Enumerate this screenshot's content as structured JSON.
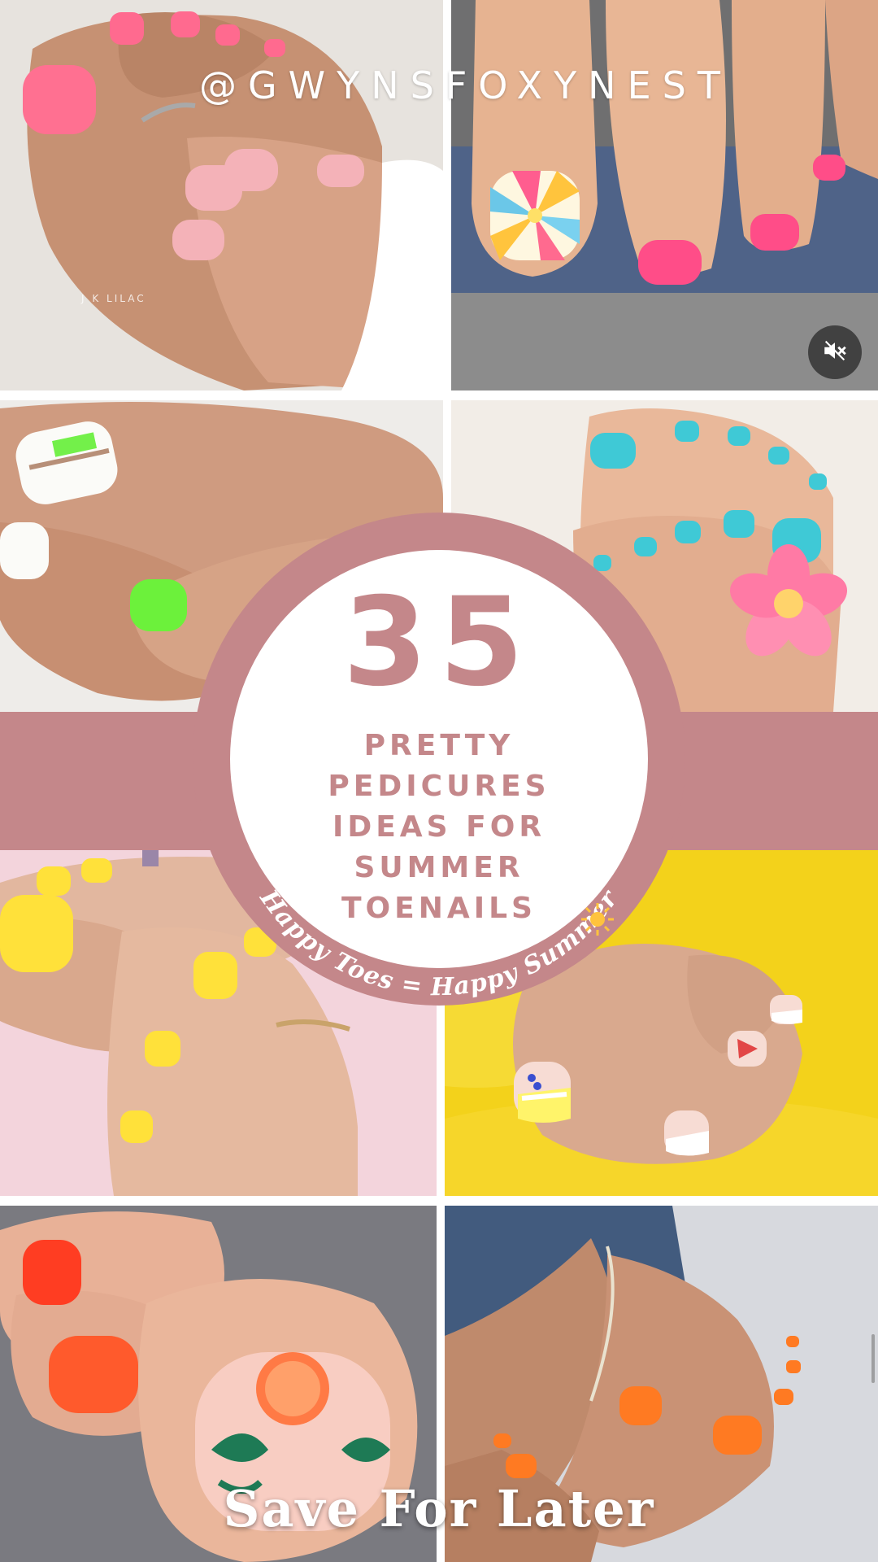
{
  "watermark": "@GWYNSFOXYNEST",
  "headline": {
    "number": "35",
    "lines": [
      "PRETTY",
      "PEDICURES",
      "IDEAS FOR",
      "SUMMER",
      "TOENAILS"
    ]
  },
  "tagline": "Happy Toes = Happy Summer",
  "cta": "Save For Later",
  "tiles": [
    {
      "name": "neon-pink-pedicure-photo",
      "credit": "J K LILAC"
    },
    {
      "name": "sunburst-toe-art-photo"
    },
    {
      "name": "neon-green-white-stripe-photo"
    },
    {
      "name": "turquoise-plumeria-photo"
    },
    {
      "name": "yellow-toenails-photo"
    },
    {
      "name": "french-tip-yellow-stripe-photo"
    },
    {
      "name": "orange-citrus-toe-art-photo"
    },
    {
      "name": "orange-toenails-jeans-photo"
    }
  ],
  "icons": {
    "mute": "muted-speaker-icon",
    "sun": "sun-icon"
  },
  "colors": {
    "accent": "#c4878a",
    "text_light": "#ffffff"
  }
}
